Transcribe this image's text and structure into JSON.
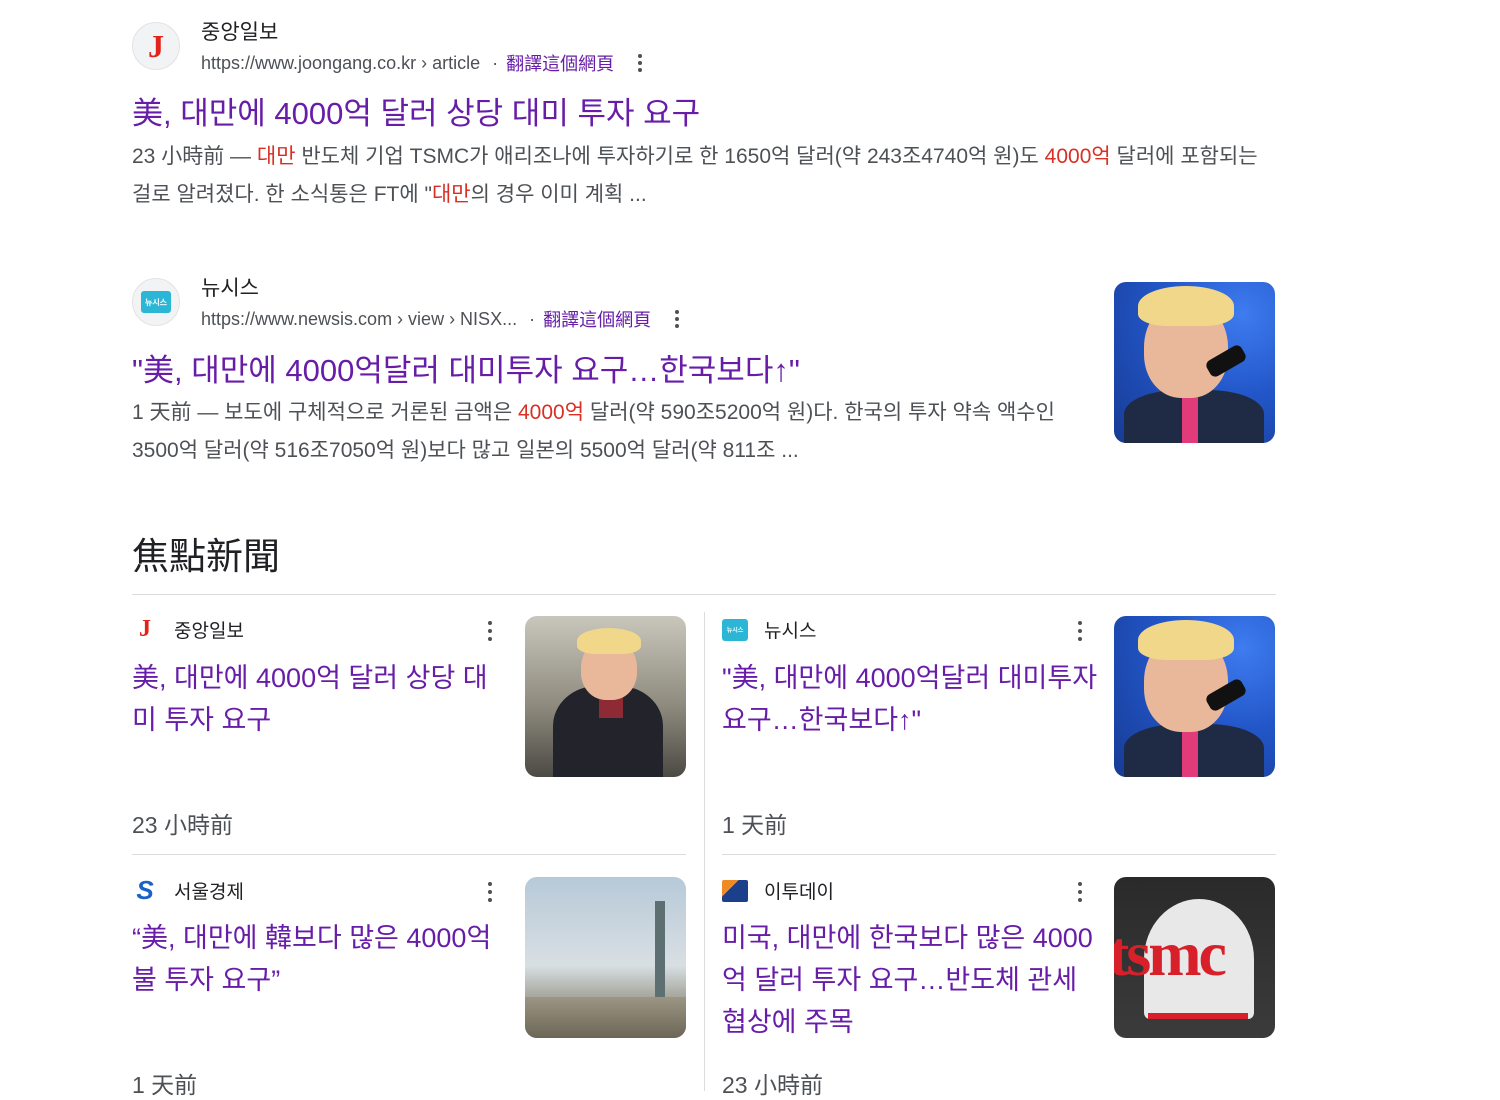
{
  "results": [
    {
      "site_name": "중앙일보",
      "favicon_letter": "J",
      "url": "https://www.joongang.co.kr › article",
      "translate": "翻譯這個網頁",
      "title": "美, 대만에 4000억 달러 상당 대미 투자 요구",
      "snippet": [
        {
          "t": "23 小時前 — ",
          "hl": false
        },
        {
          "t": "대만",
          "hl": true
        },
        {
          "t": " 반도체 기업 TSMC가 애리조나에 투자하기로 한 1650억 달러(약 243조4740억 원)도 ",
          "hl": false
        },
        {
          "t": "4000억",
          "hl": true
        },
        {
          "t": " 달러에 포함되는 걸로 알려졌다. 한 소식통은 FT에 \"",
          "hl": false
        },
        {
          "t": "대만",
          "hl": true
        },
        {
          "t": "의 경우 이미 계획 ...",
          "hl": false
        }
      ]
    },
    {
      "site_name": "뉴시스",
      "favicon_text": "뉴시스",
      "url": "https://www.newsis.com › view › NISX...",
      "translate": "翻譯這個網頁",
      "title": "\"美, 대만에 4000억달러 대미투자 요구…한국보다↑\"",
      "snippet": [
        {
          "t": "1 天前 — 보도에 구체적으로 거론된 금액은 ",
          "hl": false
        },
        {
          "t": "4000억",
          "hl": true
        },
        {
          "t": " 달러(약 590조5200억 원)다. 한국의 투자 약속 액수인 3500억 달러(약 516조7050억 원)보다 많고 일본의 5500억 달러(약 811조 ...",
          "hl": false
        }
      ]
    }
  ],
  "top_stories": {
    "heading": "焦點新聞",
    "cards": [
      {
        "source": "중앙일보",
        "logo": "J",
        "title": "美, 대만에 4000억 달러 상당 대미 투자 요구",
        "time": "23 小時前"
      },
      {
        "source": "뉴시스",
        "logo": "뉴시스",
        "title": "\"美, 대만에 4000억달러 대미투자 요구…한국보다↑\"",
        "time": "1 天前"
      },
      {
        "source": "서울경제",
        "logo": "S",
        "title": "“美, 대만에 韓보다 많은 4000억 불 투자 요구”",
        "time": "1 天前"
      },
      {
        "source": "이투데이",
        "logo": "",
        "title": "미국, 대만에 한국보다 많은 4000억 달러 투자 요구…반도체 관세 협상에 주목",
        "time": "23 小時前"
      }
    ],
    "thumb_text_tsmc": "tsmc"
  }
}
